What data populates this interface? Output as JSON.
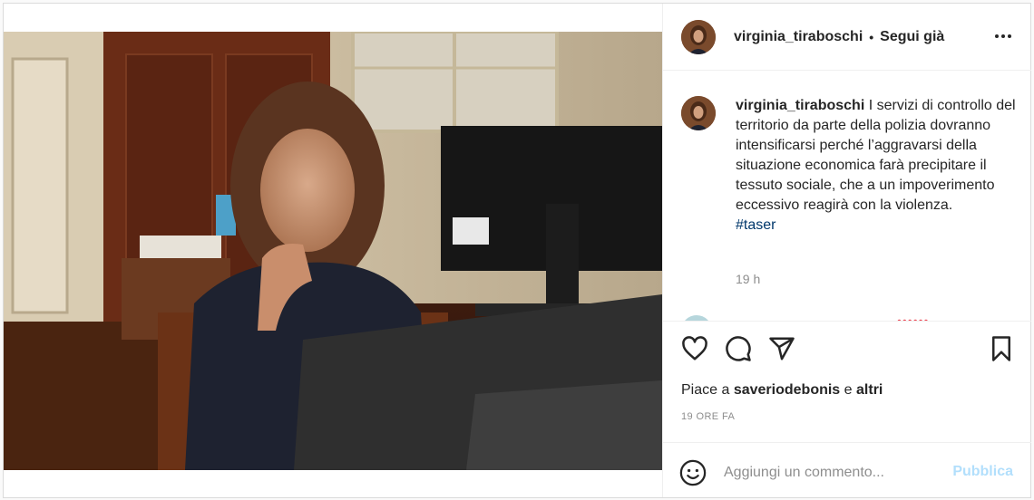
{
  "post": {
    "username": "virginia_tiraboschi",
    "separator": "•",
    "follow_label": "Segui già",
    "caption": {
      "username": "virginia_tiraboschi",
      "text": "I servizi di controllo del territorio da parte della polizia dovranno intensificarsi perché l’aggravarsi della situazione economica farà precipitare il tessuto sociale, che a un impoverimento eccessivo reagirà con la violenza.",
      "hashtag": "#taser",
      "time": "19 h"
    },
    "comment_preview_text": "••••••",
    "likes": {
      "prefix": "Piace a",
      "user": "saveriodebonis",
      "conj": "e",
      "others": "altri"
    },
    "time_ago": "19 ORE FA",
    "comment_input_placeholder": "Aggiungi un commento...",
    "publish_label": "Pubblica",
    "icons": [
      "more-options-icon",
      "heart-icon",
      "comment-icon",
      "share-icon",
      "bookmark-icon",
      "emoji-icon"
    ],
    "colors": {
      "link": "#00376b",
      "publish": "#b2dffc",
      "muted": "#8e8e8e",
      "text": "#262626"
    }
  }
}
